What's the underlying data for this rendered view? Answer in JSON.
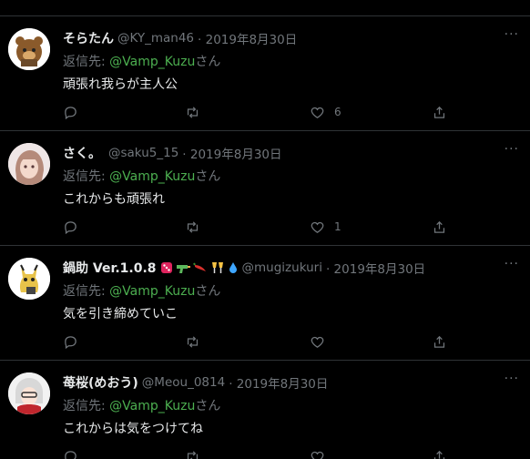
{
  "colors": {
    "background": "#000000",
    "muted": "#71767b",
    "text": "#e7e9ea",
    "mention": "#4caf50"
  },
  "tweets": [
    {
      "name": "そらたん",
      "handle": "@KY_man46",
      "date": "· 2019年8月30日",
      "reply_prefix": "返信先: ",
      "reply_to": "@Vamp_Kuzu",
      "reply_suffix": "さん",
      "text": "頑張れ我らが主人公",
      "like_count": "6"
    },
    {
      "name": "さく。",
      "handle": "@saku5_15",
      "date": "· 2019年8月30日",
      "reply_prefix": "返信先: ",
      "reply_to": "@Vamp_Kuzu",
      "reply_suffix": "さん",
      "text": "これからも頑張れ",
      "like_count": "1"
    },
    {
      "name": "鍋助 Ver.1.0.8",
      "emojis": [
        "die-icon",
        "water-gun-icon",
        "chili-icon",
        "cheers-icon",
        "droplet-icon"
      ],
      "handle": "@mugizukuri",
      "date": "· 2019年8月30日",
      "reply_prefix": "返信先: ",
      "reply_to": "@Vamp_Kuzu",
      "reply_suffix": "さん",
      "text": "気を引き締めていこ",
      "like_count": ""
    },
    {
      "name": "苺桜(めおう)",
      "handle": "@Meou_0814",
      "date": "· 2019年8月30日",
      "reply_prefix": "返信先: ",
      "reply_to": "@Vamp_Kuzu",
      "reply_suffix": "さん",
      "text": "これからは気をつけてね",
      "like_count": ""
    }
  ],
  "more_label": "···"
}
